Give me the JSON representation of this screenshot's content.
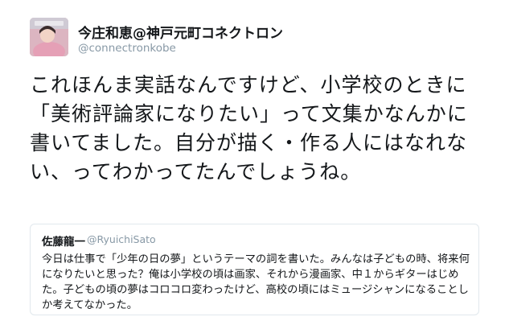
{
  "tweet": {
    "author_name": "今庄和恵@神戸元町コネクトロン",
    "author_handle": "@connectronkobe",
    "avatar_icon": "profile-photo-icon",
    "text": "これほんま実話なんですけど、小学校のときに「美術評論家になりたい」って文集かなんかに書いてました。自分が描く・作る人にはなれない、ってわかってたんでしょうね。"
  },
  "quoted_tweet": {
    "author_name": "佐藤龍一",
    "author_handle": "@RyuichiSato",
    "text": "今日は仕事で「少年の日の夢」というテーマの詞を書いた。みんなは子どもの時、将来何になりたいと思った？俺は小学校の頃は画家、それから漫画家、中１からギターはじめた。子どもの頃の夢はコロコロ変わったけど、高校の頃にはミュージシャンになることしか考えてなかった。"
  },
  "colors": {
    "text": "#14171a",
    "secondary_text": "#8899a6",
    "border": "#e1e8ed"
  }
}
